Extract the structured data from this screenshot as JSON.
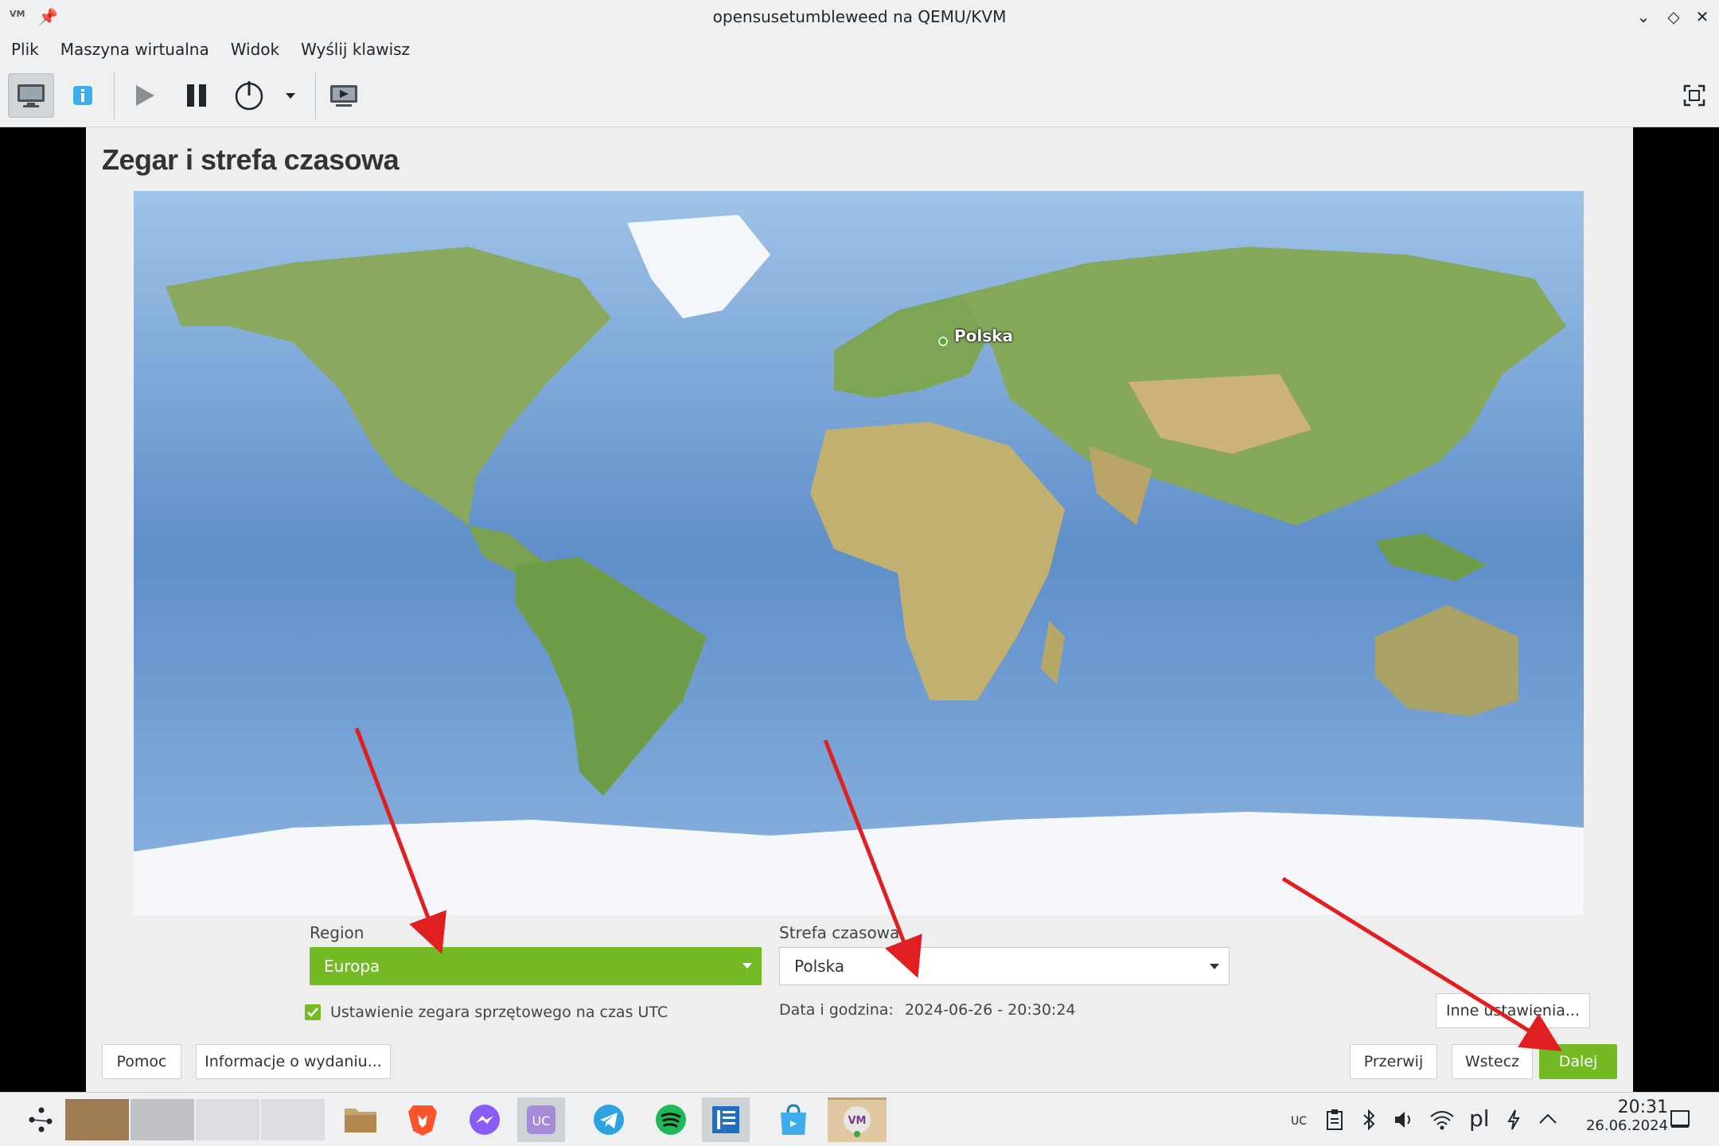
{
  "window": {
    "title": "opensusetumbleweed na QEMU/KVM",
    "app_icon_text": "VM"
  },
  "menu": [
    "Plik",
    "Maszyna wirtualna",
    "Widok",
    "Wyślij klawisz"
  ],
  "toolbar": {
    "icons": [
      "console-icon",
      "info-icon",
      "run-icon",
      "pause-icon",
      "power-icon",
      "dropdown-icon",
      "screenshot-icon",
      "fullscreen-icon"
    ]
  },
  "installer": {
    "title": "Zegar i strefa czasowa",
    "map_city": "Polska",
    "region_label": "Region",
    "region_value": "Europa",
    "timezone_label": "Strefa czasowa",
    "timezone_value": "Polska",
    "utc_label": "Ustawienie zegara sprzętowego na czas UTC",
    "utc_checked": true,
    "datetime_label": "Data i godzina:",
    "datetime_value": "2024-06-26 - 20:30:24",
    "other_settings": "Inne ustawienia...",
    "buttons": {
      "help": "Pomoc",
      "release_notes": "Informacje o wydaniu...",
      "abort": "Przerwij",
      "back": "Wstecz",
      "next": "Dalej"
    },
    "colors": {
      "accent": "#73ba25",
      "annotation_arrow": "#e02020"
    }
  },
  "taskbar": {
    "apps": [
      "launcher-icon",
      "files-icon",
      "brave-icon",
      "messenger-icon",
      "vpn-icon",
      "telegram-icon",
      "spotify-icon",
      "notes-icon",
      "store-icon",
      "virt-manager-icon"
    ],
    "tray": [
      "vpn-tray-icon",
      "clipboard-icon",
      "bluetooth-icon",
      "volume-icon",
      "wifi-icon",
      "pl",
      "power-icon",
      "expand-icon"
    ],
    "clock_time": "20:31",
    "clock_date": "26.06.2024"
  }
}
